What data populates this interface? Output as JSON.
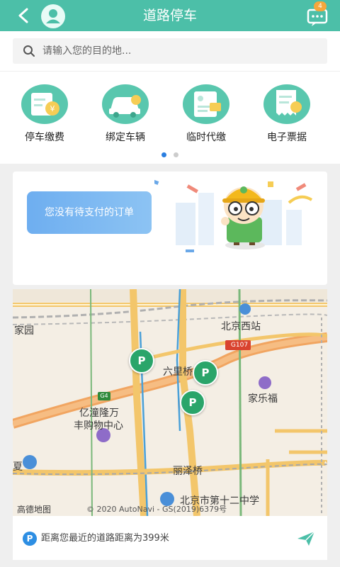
{
  "header": {
    "title": "道路停车",
    "badge_count": "4"
  },
  "search": {
    "placeholder": "请输入您的目的地..."
  },
  "quick_actions": [
    {
      "label": "停车缴费",
      "icon": "parking-fee-icon"
    },
    {
      "label": "绑定车辆",
      "icon": "car-icon"
    },
    {
      "label": "临时代缴",
      "icon": "temp-payment-icon"
    },
    {
      "label": "电子票据",
      "icon": "e-receipt-icon"
    }
  ],
  "pager": {
    "count": 2,
    "active": 0
  },
  "order_card": {
    "message": "您没有待支付的订单"
  },
  "map": {
    "labels": {
      "jiayuan": "家园",
      "beijing_west": "北京西站",
      "g107": "G107",
      "liulicheng": "六里桥",
      "jialefu": "家乐福",
      "g4": "G4",
      "yitong": "亿潼隆万",
      "fengou": "丰购物中心",
      "xia": "夏",
      "lizeqiao": "丽泽桥",
      "school": "北京市第十二中学",
      "brand": "高德地图",
      "copyright": "© 2020 AutoNavi - GS(2019)6379号"
    },
    "pin_label": "P"
  },
  "nearest": {
    "text": "距离您最近的道路距离为399米",
    "badge": "P"
  },
  "colors": {
    "primary": "#4cbfa8",
    "accent_blue": "#2d8ee3",
    "pin_green": "#2aa56a",
    "badge_orange": "#f4a73c"
  }
}
